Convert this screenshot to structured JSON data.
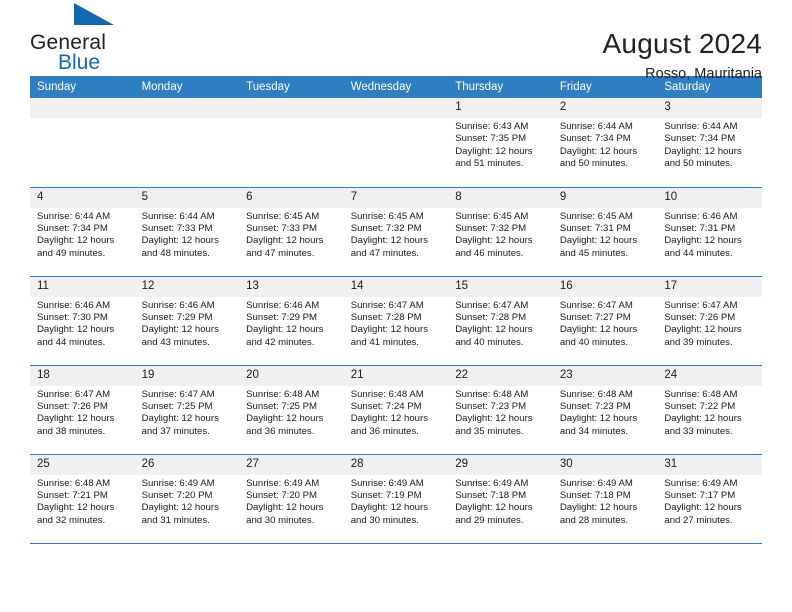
{
  "brand": {
    "name_part1": "General",
    "name_part2": "Blue",
    "accent_color": "#1468b3"
  },
  "header": {
    "title": "August 2024",
    "location": "Rosso, Mauritania"
  },
  "calendar": {
    "header_background": "#2f7ec1",
    "weekday_headers": [
      "Sunday",
      "Monday",
      "Tuesday",
      "Wednesday",
      "Thursday",
      "Friday",
      "Saturday"
    ],
    "weeks": [
      [
        {
          "day": "",
          "empty": true
        },
        {
          "day": "",
          "empty": true
        },
        {
          "day": "",
          "empty": true
        },
        {
          "day": "",
          "empty": true
        },
        {
          "day": "1",
          "sunrise": "Sunrise: 6:43 AM",
          "sunset": "Sunset: 7:35 PM",
          "daylight_line1": "Daylight: 12 hours",
          "daylight_line2": "and 51 minutes."
        },
        {
          "day": "2",
          "sunrise": "Sunrise: 6:44 AM",
          "sunset": "Sunset: 7:34 PM",
          "daylight_line1": "Daylight: 12 hours",
          "daylight_line2": "and 50 minutes."
        },
        {
          "day": "3",
          "sunrise": "Sunrise: 6:44 AM",
          "sunset": "Sunset: 7:34 PM",
          "daylight_line1": "Daylight: 12 hours",
          "daylight_line2": "and 50 minutes."
        }
      ],
      [
        {
          "day": "4",
          "sunrise": "Sunrise: 6:44 AM",
          "sunset": "Sunset: 7:34 PM",
          "daylight_line1": "Daylight: 12 hours",
          "daylight_line2": "and 49 minutes."
        },
        {
          "day": "5",
          "sunrise": "Sunrise: 6:44 AM",
          "sunset": "Sunset: 7:33 PM",
          "daylight_line1": "Daylight: 12 hours",
          "daylight_line2": "and 48 minutes."
        },
        {
          "day": "6",
          "sunrise": "Sunrise: 6:45 AM",
          "sunset": "Sunset: 7:33 PM",
          "daylight_line1": "Daylight: 12 hours",
          "daylight_line2": "and 47 minutes."
        },
        {
          "day": "7",
          "sunrise": "Sunrise: 6:45 AM",
          "sunset": "Sunset: 7:32 PM",
          "daylight_line1": "Daylight: 12 hours",
          "daylight_line2": "and 47 minutes."
        },
        {
          "day": "8",
          "sunrise": "Sunrise: 6:45 AM",
          "sunset": "Sunset: 7:32 PM",
          "daylight_line1": "Daylight: 12 hours",
          "daylight_line2": "and 46 minutes."
        },
        {
          "day": "9",
          "sunrise": "Sunrise: 6:45 AM",
          "sunset": "Sunset: 7:31 PM",
          "daylight_line1": "Daylight: 12 hours",
          "daylight_line2": "and 45 minutes."
        },
        {
          "day": "10",
          "sunrise": "Sunrise: 6:46 AM",
          "sunset": "Sunset: 7:31 PM",
          "daylight_line1": "Daylight: 12 hours",
          "daylight_line2": "and 44 minutes."
        }
      ],
      [
        {
          "day": "11",
          "sunrise": "Sunrise: 6:46 AM",
          "sunset": "Sunset: 7:30 PM",
          "daylight_line1": "Daylight: 12 hours",
          "daylight_line2": "and 44 minutes."
        },
        {
          "day": "12",
          "sunrise": "Sunrise: 6:46 AM",
          "sunset": "Sunset: 7:29 PM",
          "daylight_line1": "Daylight: 12 hours",
          "daylight_line2": "and 43 minutes."
        },
        {
          "day": "13",
          "sunrise": "Sunrise: 6:46 AM",
          "sunset": "Sunset: 7:29 PM",
          "daylight_line1": "Daylight: 12 hours",
          "daylight_line2": "and 42 minutes."
        },
        {
          "day": "14",
          "sunrise": "Sunrise: 6:47 AM",
          "sunset": "Sunset: 7:28 PM",
          "daylight_line1": "Daylight: 12 hours",
          "daylight_line2": "and 41 minutes."
        },
        {
          "day": "15",
          "sunrise": "Sunrise: 6:47 AM",
          "sunset": "Sunset: 7:28 PM",
          "daylight_line1": "Daylight: 12 hours",
          "daylight_line2": "and 40 minutes."
        },
        {
          "day": "16",
          "sunrise": "Sunrise: 6:47 AM",
          "sunset": "Sunset: 7:27 PM",
          "daylight_line1": "Daylight: 12 hours",
          "daylight_line2": "and 40 minutes."
        },
        {
          "day": "17",
          "sunrise": "Sunrise: 6:47 AM",
          "sunset": "Sunset: 7:26 PM",
          "daylight_line1": "Daylight: 12 hours",
          "daylight_line2": "and 39 minutes."
        }
      ],
      [
        {
          "day": "18",
          "sunrise": "Sunrise: 6:47 AM",
          "sunset": "Sunset: 7:26 PM",
          "daylight_line1": "Daylight: 12 hours",
          "daylight_line2": "and 38 minutes."
        },
        {
          "day": "19",
          "sunrise": "Sunrise: 6:47 AM",
          "sunset": "Sunset: 7:25 PM",
          "daylight_line1": "Daylight: 12 hours",
          "daylight_line2": "and 37 minutes."
        },
        {
          "day": "20",
          "sunrise": "Sunrise: 6:48 AM",
          "sunset": "Sunset: 7:25 PM",
          "daylight_line1": "Daylight: 12 hours",
          "daylight_line2": "and 36 minutes."
        },
        {
          "day": "21",
          "sunrise": "Sunrise: 6:48 AM",
          "sunset": "Sunset: 7:24 PM",
          "daylight_line1": "Daylight: 12 hours",
          "daylight_line2": "and 36 minutes."
        },
        {
          "day": "22",
          "sunrise": "Sunrise: 6:48 AM",
          "sunset": "Sunset: 7:23 PM",
          "daylight_line1": "Daylight: 12 hours",
          "daylight_line2": "and 35 minutes."
        },
        {
          "day": "23",
          "sunrise": "Sunrise: 6:48 AM",
          "sunset": "Sunset: 7:23 PM",
          "daylight_line1": "Daylight: 12 hours",
          "daylight_line2": "and 34 minutes."
        },
        {
          "day": "24",
          "sunrise": "Sunrise: 6:48 AM",
          "sunset": "Sunset: 7:22 PM",
          "daylight_line1": "Daylight: 12 hours",
          "daylight_line2": "and 33 minutes."
        }
      ],
      [
        {
          "day": "25",
          "sunrise": "Sunrise: 6:48 AM",
          "sunset": "Sunset: 7:21 PM",
          "daylight_line1": "Daylight: 12 hours",
          "daylight_line2": "and 32 minutes."
        },
        {
          "day": "26",
          "sunrise": "Sunrise: 6:49 AM",
          "sunset": "Sunset: 7:20 PM",
          "daylight_line1": "Daylight: 12 hours",
          "daylight_line2": "and 31 minutes."
        },
        {
          "day": "27",
          "sunrise": "Sunrise: 6:49 AM",
          "sunset": "Sunset: 7:20 PM",
          "daylight_line1": "Daylight: 12 hours",
          "daylight_line2": "and 30 minutes."
        },
        {
          "day": "28",
          "sunrise": "Sunrise: 6:49 AM",
          "sunset": "Sunset: 7:19 PM",
          "daylight_line1": "Daylight: 12 hours",
          "daylight_line2": "and 30 minutes."
        },
        {
          "day": "29",
          "sunrise": "Sunrise: 6:49 AM",
          "sunset": "Sunset: 7:18 PM",
          "daylight_line1": "Daylight: 12 hours",
          "daylight_line2": "and 29 minutes."
        },
        {
          "day": "30",
          "sunrise": "Sunrise: 6:49 AM",
          "sunset": "Sunset: 7:18 PM",
          "daylight_line1": "Daylight: 12 hours",
          "daylight_line2": "and 28 minutes."
        },
        {
          "day": "31",
          "sunrise": "Sunrise: 6:49 AM",
          "sunset": "Sunset: 7:17 PM",
          "daylight_line1": "Daylight: 12 hours",
          "daylight_line2": "and 27 minutes."
        }
      ]
    ]
  }
}
